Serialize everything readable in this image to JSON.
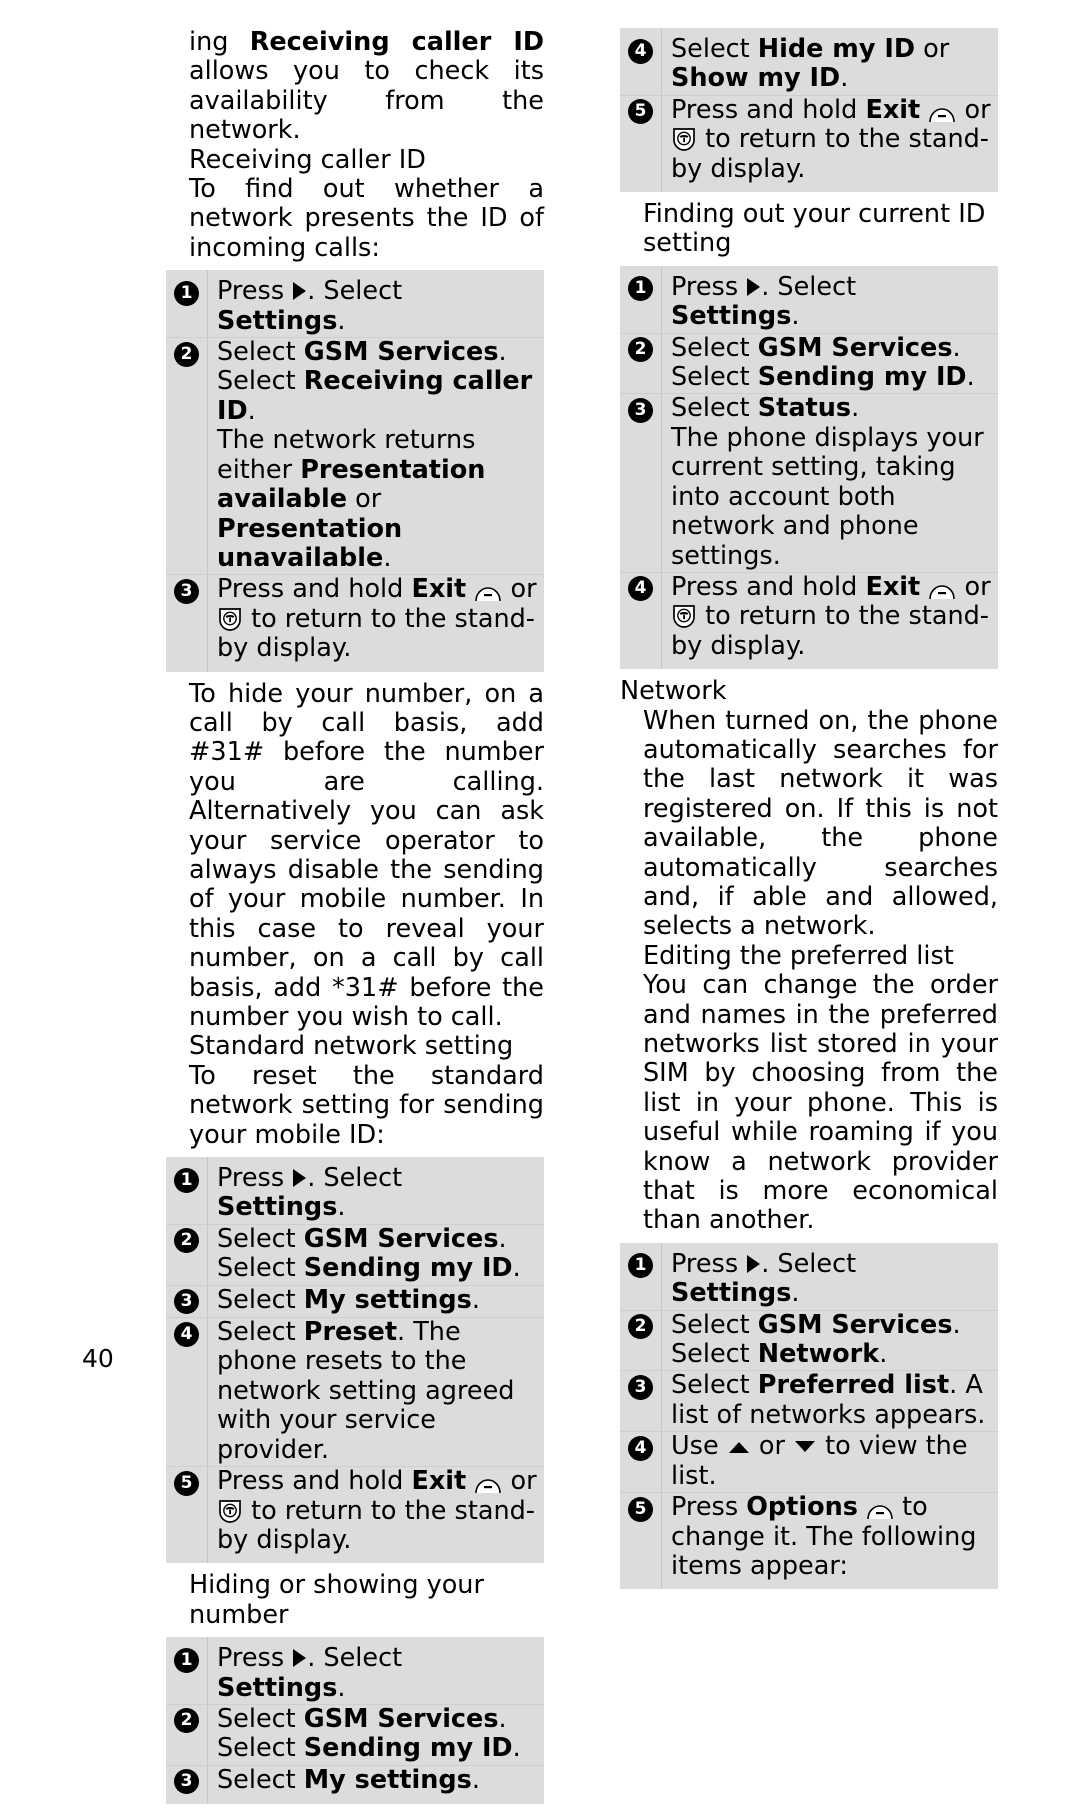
{
  "page": {
    "number": "40",
    "colors": {
      "box_bg": "#dcdcdc",
      "text": "#000000",
      "page_bg": "#ffffff"
    }
  },
  "icons": {
    "soft_key": "soft-key-icon",
    "hangup_key": "hangup-key-icon",
    "right_arrow": "right-arrow-icon",
    "up_arrow": "up-arrow-icon",
    "down_arrow": "down-arrow-icon"
  },
  "left_column": {
    "para_intro_1": "ing ",
    "para_intro_bold": "Receiving caller ID",
    "para_intro_2": " allows you to check its availability from the network.",
    "subheading_receiving": "Receiving caller ID",
    "para_findout": "To find out whether a network presents the ID of incoming calls:",
    "steps_receiving": [
      {
        "num": "1",
        "parts": [
          {
            "t": "Press ",
            "b": false
          },
          {
            "t": "__ARROW_RIGHT__",
            "b": false
          },
          {
            "t": ". Select ",
            "b": false
          },
          {
            "t": "Settings",
            "b": true
          },
          {
            "t": ".",
            "b": false
          }
        ]
      },
      {
        "num": "2",
        "parts": [
          {
            "t": "Select ",
            "b": false
          },
          {
            "t": "GSM Services",
            "b": true
          },
          {
            "t": ". Select ",
            "b": false
          },
          {
            "t": "Receiving caller ID",
            "b": true
          },
          {
            "t": ".",
            "b": false
          },
          {
            "t": "__BR__",
            "b": false
          },
          {
            "t": "The network returns either ",
            "b": false
          },
          {
            "t": "Presentation available",
            "b": true
          },
          {
            "t": " or ",
            "b": false
          },
          {
            "t": "Presentation unavailable",
            "b": true
          },
          {
            "t": ".",
            "b": false
          }
        ]
      },
      {
        "num": "3",
        "parts": [
          {
            "t": "Press and hold ",
            "b": false
          },
          {
            "t": "Exit",
            "b": true
          },
          {
            "t": " ",
            "b": false
          },
          {
            "t": "__SOFTKEY__",
            "b": false
          },
          {
            "t": " or ",
            "b": false
          },
          {
            "t": "__HANGUP__",
            "b": false
          },
          {
            "t": " to return to the stand-by display.",
            "b": false
          }
        ]
      }
    ],
    "para_hide": "To hide your number, on a call by call basis, add #31# before the number you are calling. Alternatively you can ask your service operator to always disable the sending of your mobile number. In this case to reveal your number, on a call by call basis, add *31# before the number you wish to call.",
    "subheading_standard": "Standard network setting",
    "para_reset": "To reset the standard network setting for sending your mobile ID:",
    "steps_standard": [
      {
        "num": "1",
        "parts": [
          {
            "t": "Press ",
            "b": false
          },
          {
            "t": "__ARROW_RIGHT__",
            "b": false
          },
          {
            "t": ". Select ",
            "b": false
          },
          {
            "t": "Settings",
            "b": true
          },
          {
            "t": ".",
            "b": false
          }
        ]
      },
      {
        "num": "2",
        "parts": [
          {
            "t": "Select ",
            "b": false
          },
          {
            "t": "GSM Services",
            "b": true
          },
          {
            "t": ". Select ",
            "b": false
          },
          {
            "t": "Sending my ID",
            "b": true
          },
          {
            "t": ".",
            "b": false
          }
        ]
      },
      {
        "num": "3",
        "parts": [
          {
            "t": "Select ",
            "b": false
          },
          {
            "t": "My settings",
            "b": true
          },
          {
            "t": ".",
            "b": false
          }
        ]
      },
      {
        "num": "4",
        "parts": [
          {
            "t": "Select ",
            "b": false
          },
          {
            "t": "Preset",
            "b": true
          },
          {
            "t": ". The phone resets to the network setting agreed with your service provider.",
            "b": false
          }
        ]
      },
      {
        "num": "5",
        "parts": [
          {
            "t": "Press and hold ",
            "b": false
          },
          {
            "t": "Exit",
            "b": true
          },
          {
            "t": " ",
            "b": false
          },
          {
            "t": "__SOFTKEY__",
            "b": false
          },
          {
            "t": " or ",
            "b": false
          },
          {
            "t": "__HANGUP__",
            "b": false
          },
          {
            "t": " to return to the stand-by display.",
            "b": false
          }
        ]
      }
    ],
    "subheading_hiding": "Hiding or showing your number",
    "steps_hiding": [
      {
        "num": "1",
        "parts": [
          {
            "t": "Press ",
            "b": false
          },
          {
            "t": "__ARROW_RIGHT__",
            "b": false
          },
          {
            "t": ". Select ",
            "b": false
          },
          {
            "t": "Settings",
            "b": true
          },
          {
            "t": ".",
            "b": false
          }
        ]
      },
      {
        "num": "2",
        "parts": [
          {
            "t": "Select ",
            "b": false
          },
          {
            "t": "GSM Services",
            "b": true
          },
          {
            "t": ". Select ",
            "b": false
          },
          {
            "t": "Sending my ID",
            "b": true
          },
          {
            "t": ".",
            "b": false
          }
        ]
      },
      {
        "num": "3",
        "parts": [
          {
            "t": "Select ",
            "b": false
          },
          {
            "t": "My settings",
            "b": true
          },
          {
            "t": ".",
            "b": false
          }
        ]
      }
    ]
  },
  "right_column": {
    "steps_hiding_cont": [
      {
        "num": "4",
        "parts": [
          {
            "t": "Select ",
            "b": false
          },
          {
            "t": "Hide my ID",
            "b": true
          },
          {
            "t": " or ",
            "b": false
          },
          {
            "t": "Show my ID",
            "b": true
          },
          {
            "t": ".",
            "b": false
          }
        ]
      },
      {
        "num": "5",
        "parts": [
          {
            "t": "Press and hold ",
            "b": false
          },
          {
            "t": "Exit",
            "b": true
          },
          {
            "t": " ",
            "b": false
          },
          {
            "t": "__SOFTKEY__",
            "b": false
          },
          {
            "t": " or ",
            "b": false
          },
          {
            "t": "__HANGUP__",
            "b": false
          },
          {
            "t": " to return to the stand-by display.",
            "b": false
          }
        ]
      }
    ],
    "subheading_finding": "Finding out your current ID setting",
    "steps_finding": [
      {
        "num": "1",
        "parts": [
          {
            "t": "Press ",
            "b": false
          },
          {
            "t": "__ARROW_RIGHT__",
            "b": false
          },
          {
            "t": ". Select ",
            "b": false
          },
          {
            "t": "Settings",
            "b": true
          },
          {
            "t": ".",
            "b": false
          }
        ]
      },
      {
        "num": "2",
        "parts": [
          {
            "t": "Select ",
            "b": false
          },
          {
            "t": "GSM Services",
            "b": true
          },
          {
            "t": ". Select ",
            "b": false
          },
          {
            "t": "Sending my ID",
            "b": true
          },
          {
            "t": ".",
            "b": false
          }
        ]
      },
      {
        "num": "3",
        "parts": [
          {
            "t": "Select ",
            "b": false
          },
          {
            "t": "Status",
            "b": true
          },
          {
            "t": ".",
            "b": false
          },
          {
            "t": "__BR__",
            "b": false
          },
          {
            "t": "The phone displays your current setting, taking into account both network and phone settings.",
            "b": false
          }
        ]
      },
      {
        "num": "4",
        "parts": [
          {
            "t": "Press and hold ",
            "b": false
          },
          {
            "t": "Exit",
            "b": true
          },
          {
            "t": " ",
            "b": false
          },
          {
            "t": "__SOFTKEY__",
            "b": false
          },
          {
            "t": " or ",
            "b": false
          },
          {
            "t": "__HANGUP__",
            "b": false
          },
          {
            "t": " to return to the stand-by display.",
            "b": false
          }
        ]
      }
    ],
    "heading_network": "Network",
    "para_network": "When turned on, the phone automatically searches for the last network it was registered on. If this is not available, the phone automatically searches and, if able and allowed, selects a network.",
    "subheading_editing": "Editing the preferred list",
    "para_editing": "You can change the order and names in the preferred networks list stored in your SIM by choosing from the list in your phone. This is useful while roaming if you know a network provider that is more economical than another.",
    "steps_network": [
      {
        "num": "1",
        "parts": [
          {
            "t": "Press ",
            "b": false
          },
          {
            "t": "__ARROW_RIGHT__",
            "b": false
          },
          {
            "t": ". Select ",
            "b": false
          },
          {
            "t": "Settings",
            "b": true
          },
          {
            "t": ".",
            "b": false
          }
        ]
      },
      {
        "num": "2",
        "parts": [
          {
            "t": "Select ",
            "b": false
          },
          {
            "t": "GSM Services",
            "b": true
          },
          {
            "t": ". Select ",
            "b": false
          },
          {
            "t": "Network",
            "b": true
          },
          {
            "t": ".",
            "b": false
          }
        ]
      },
      {
        "num": "3",
        "parts": [
          {
            "t": "Select ",
            "b": false
          },
          {
            "t": "Preferred list",
            "b": true
          },
          {
            "t": ". A list of networks appears.",
            "b": false
          }
        ]
      },
      {
        "num": "4",
        "parts": [
          {
            "t": "Use ",
            "b": false
          },
          {
            "t": "__ARROW_UP__",
            "b": false
          },
          {
            "t": " or ",
            "b": false
          },
          {
            "t": "__ARROW_DOWN__",
            "b": false
          },
          {
            "t": " to view the list.",
            "b": false
          }
        ]
      },
      {
        "num": "5",
        "parts": [
          {
            "t": "Press ",
            "b": false
          },
          {
            "t": "Options",
            "b": true
          },
          {
            "t": " ",
            "b": false
          },
          {
            "t": "__SOFTKEY__",
            "b": false
          },
          {
            "t": " to change it. The following items appear:",
            "b": false
          }
        ]
      }
    ]
  }
}
